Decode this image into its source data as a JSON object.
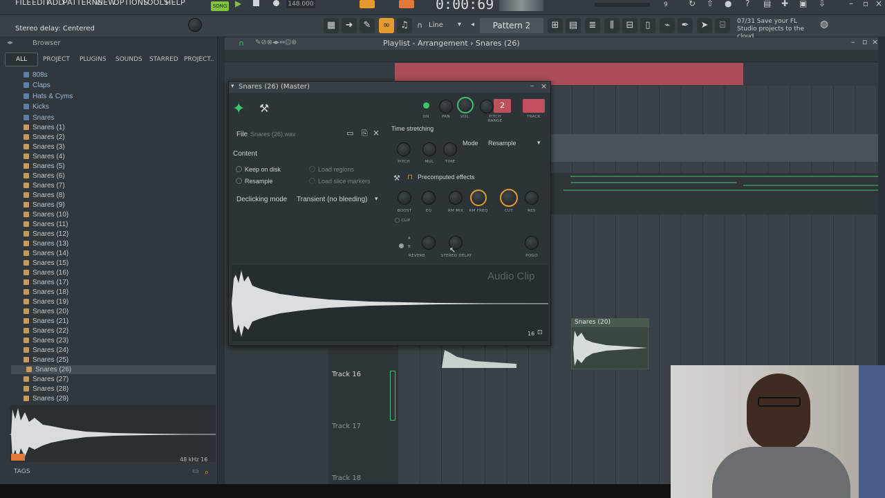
{
  "menu": {
    "items": [
      "FILE",
      "EDIT",
      "ADD",
      "PATTERNS",
      "VIEW",
      "OPTIONS",
      "TOOLS",
      "HELP"
    ],
    "song_label": "SONG",
    "tempo": "148.000",
    "time": "0:00:69",
    "cpu": "9"
  },
  "hint": {
    "text": "Stereo delay: Centered"
  },
  "toolbar": {
    "snap": "Line",
    "pattern": "Pattern 2",
    "news": "07/31 Save your FL Studio projects to the cloud"
  },
  "browser": {
    "title": "Browser",
    "tabs": [
      "ALL",
      "PROJECT",
      "PLUGINS",
      "SOUNDS",
      "STARRED",
      "PROJECT.."
    ],
    "folders": [
      "808s",
      "Claps",
      "Hats & Cyms",
      "Kicks",
      "Snares"
    ],
    "files": [
      "Snares (1)",
      "Snares (2)",
      "Snares (3)",
      "Snares (4)",
      "Snares (5)",
      "Snares (6)",
      "Snares (7)",
      "Snares (8)",
      "Snares (9)",
      "Snares (10)",
      "Snares (11)",
      "Snares (12)",
      "Snares (13)",
      "Snares (14)",
      "Snares (15)",
      "Snares (16)",
      "Snares (17)",
      "Snares (18)",
      "Snares (19)",
      "Snares (20)",
      "Snares (21)",
      "Snares (22)",
      "Snares (23)",
      "Snares (24)",
      "Snares (25)",
      "Snares (26)",
      "Snares (27)",
      "Snares (28)",
      "Snares (29)"
    ],
    "selected": "Snares (26)",
    "preview_info": "48 kHz 16",
    "tags_label": "TAGS"
  },
  "playlist": {
    "title": "Playlist - Arrangement › Snares (26)",
    "clip_label": "Snares (20)",
    "tracks": [
      "Track 16",
      "Track 17",
      "Track 18"
    ]
  },
  "channel": {
    "title": "Snares (26) (Master)",
    "track_num": "2",
    "knob_labels": {
      "on": "ON",
      "pan": "PAN",
      "vol": "VOL",
      "pitch_range": "PITCH RANGE",
      "track": "TRACK"
    },
    "file_label": "File",
    "file_name": "Snares (26).wav",
    "content_label": "Content",
    "keep_on_disk": "Keep on disk",
    "resample": "Resample",
    "load_regions": "Load regions",
    "load_slice": "Load slice markers",
    "declicking_label": "Declicking mode",
    "declicking_value": "Transient (no bleeding)",
    "time_stretching": "Time stretching",
    "ts_knobs": [
      "PITCH",
      "MUL",
      "TIME"
    ],
    "mode_label": "Mode",
    "mode_value": "Resample",
    "precomputed": "Precomputed effects",
    "fx_knobs": [
      "BOOST",
      "EQ",
      "RM MIX",
      "RM FREQ",
      "CUT",
      "RES"
    ],
    "clip_label": "CLIP",
    "a_label": "A",
    "b_label": "B",
    "fx2_knobs": [
      "REVERB",
      "STEREO DELAY",
      "POGO"
    ],
    "audio_clip": "Audio Clip",
    "zoom": "16"
  },
  "colors": {
    "accent": "#3ec46d",
    "orange": "#f0a030",
    "red_clip": "#c0505e"
  }
}
